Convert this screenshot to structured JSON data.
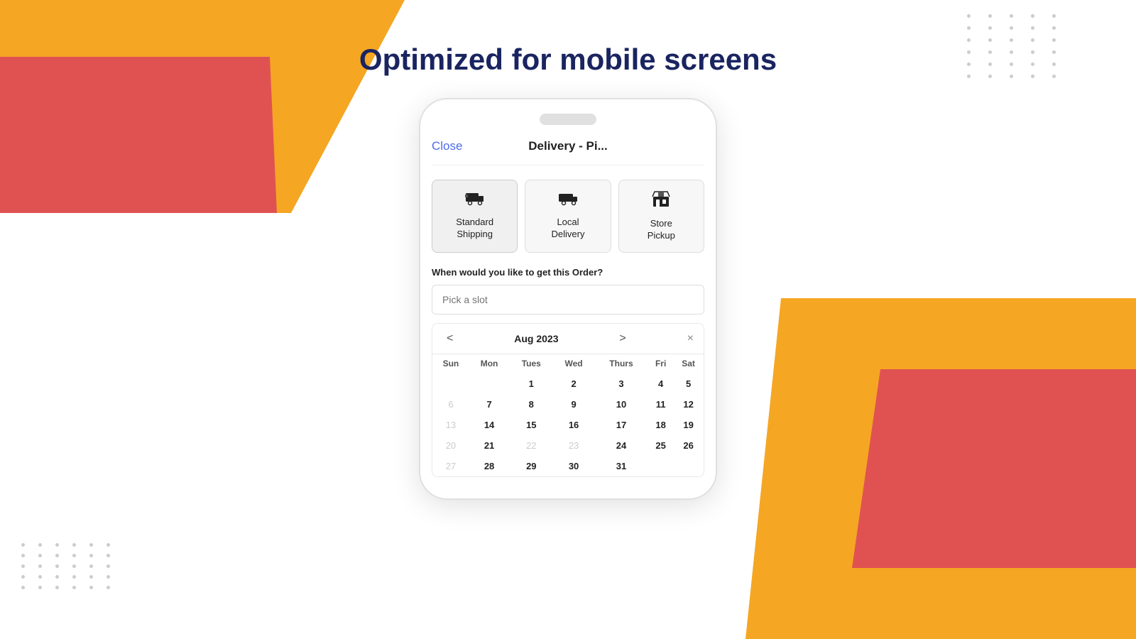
{
  "page": {
    "title": "Optimized for mobile screens"
  },
  "phone": {
    "header": {
      "close_label": "Close",
      "title": "Delivery - Pi..."
    },
    "delivery_options": [
      {
        "id": "standard",
        "label": "Standard Shipping",
        "icon": "🚚",
        "active": true
      },
      {
        "id": "local",
        "label": "Local Delivery",
        "icon": "🚛",
        "active": false
      },
      {
        "id": "store",
        "label": "Store Pickup",
        "icon": "🏪",
        "active": false
      }
    ],
    "slot_section": {
      "question": "When would you like to get this Order?",
      "placeholder": "Pick a slot"
    },
    "calendar": {
      "month": "Aug 2023",
      "prev": "<",
      "next": ">",
      "close": "×",
      "days": [
        "Sun",
        "Mon",
        "Tues",
        "Wed",
        "Thurs",
        "Fri",
        "Sat"
      ],
      "weeks": [
        [
          "",
          "",
          "1",
          "2",
          "3",
          "4",
          "5"
        ],
        [
          "6",
          "7",
          "8",
          "9",
          "10",
          "11",
          "12"
        ],
        [
          "13",
          "14",
          "15",
          "16",
          "17",
          "18",
          "19"
        ],
        [
          "20",
          "21",
          "22",
          "23",
          "24",
          "25",
          "26"
        ],
        [
          "27",
          "28",
          "29",
          "30",
          "31",
          "",
          ""
        ]
      ],
      "disabled_days": [
        "6",
        "13",
        "20",
        "22",
        "23",
        "27"
      ]
    }
  }
}
